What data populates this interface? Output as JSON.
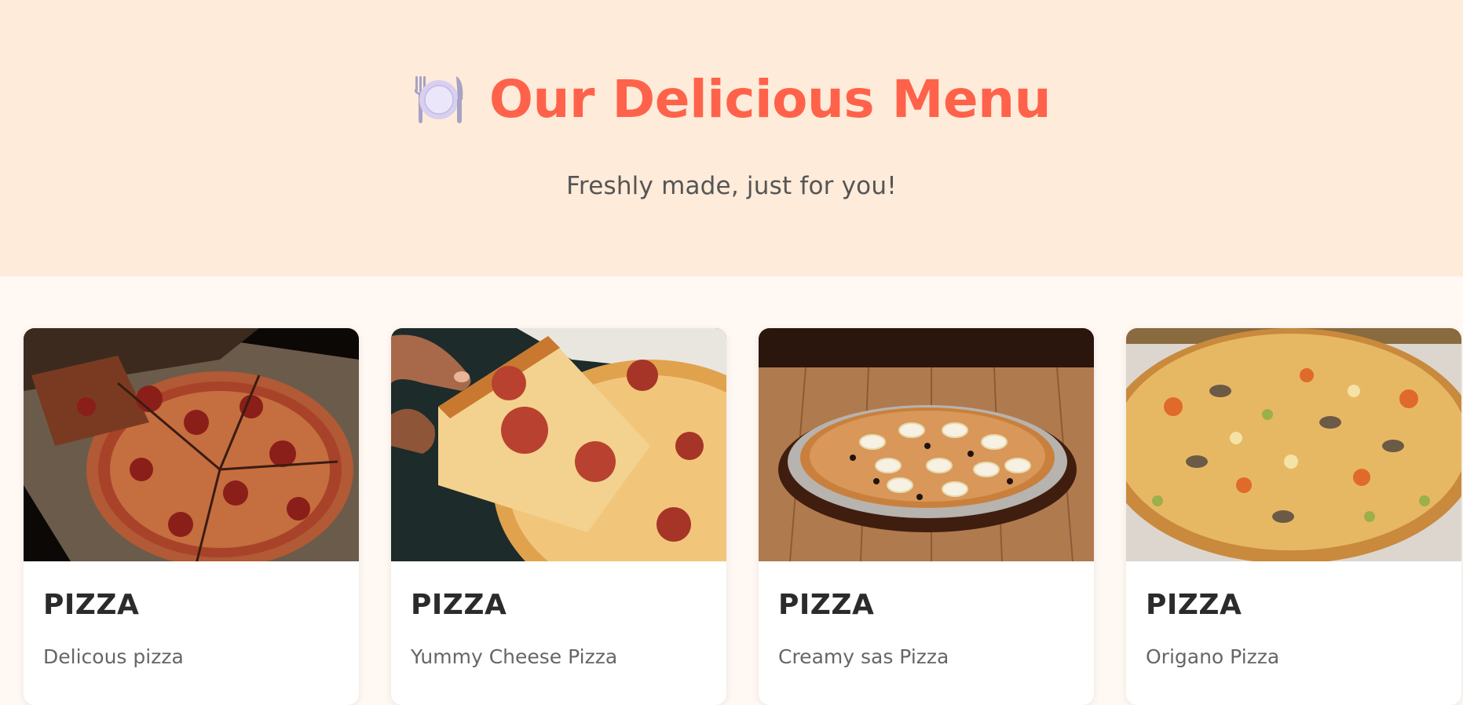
{
  "header": {
    "icon": "fork-plate-knife-icon",
    "title": "Our Delicious Menu",
    "subtitle": "Freshly made, just for you!"
  },
  "menu": {
    "items": [
      {
        "title": "PIZZA",
        "description": "Delicous pizza",
        "image": "pepperoni-pizza-photo"
      },
      {
        "title": "PIZZA",
        "description": "Yummy Cheese Pizza",
        "image": "cheese-pizza-slice-photo"
      },
      {
        "title": "PIZZA",
        "description": "Creamy sas Pizza",
        "image": "egg-olive-pizza-photo"
      },
      {
        "title": "PIZZA",
        "description": "Origano Pizza",
        "image": "vegetable-pizza-photo"
      }
    ]
  },
  "colors": {
    "accent": "#ff624a",
    "hero_bg": "#ffebd9",
    "page_bg": "#fff8f3"
  }
}
